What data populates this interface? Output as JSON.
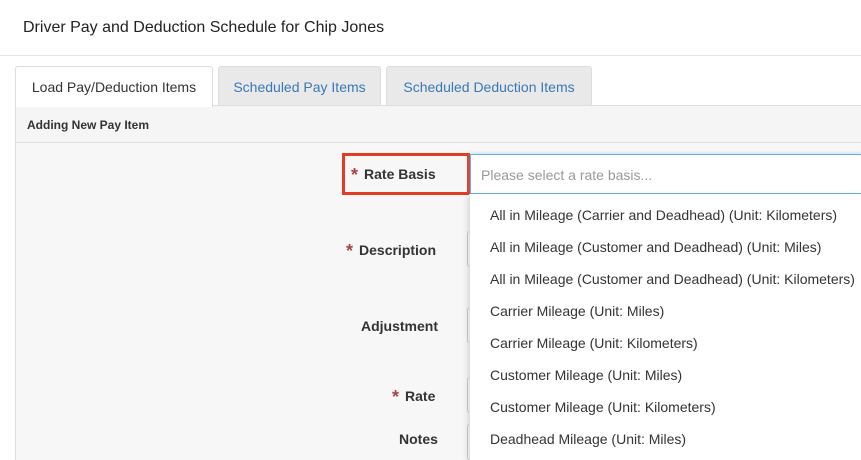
{
  "modal": {
    "title": "Driver Pay and Deduction Schedule for Chip Jones"
  },
  "tabs": [
    {
      "label": "Load Pay/Deduction Items",
      "active": true
    },
    {
      "label": "Scheduled Pay Items",
      "active": false
    },
    {
      "label": "Scheduled Deduction Items",
      "active": false
    }
  ],
  "panel": {
    "heading": "Adding New Pay Item"
  },
  "form": {
    "required_marker": "*",
    "rate_basis_label": "Rate Basis",
    "rate_basis_placeholder": "Please select a rate basis...",
    "description_label": "Description",
    "adjustment_label": "Adjustment",
    "rate_label": "Rate",
    "notes_label": "Notes"
  },
  "dropdown": {
    "options": [
      "All in Mileage (Carrier and Deadhead) (Unit: Kilometers)",
      "All in Mileage (Customer and Deadhead) (Unit: Miles)",
      "All in Mileage (Customer and Deadhead) (Unit: Kilometers)",
      "Carrier Mileage (Unit: Miles)",
      "Carrier Mileage (Unit: Kilometers)",
      "Customer Mileage (Unit: Miles)",
      "Customer Mileage (Unit: Kilometers)",
      "Deadhead Mileage (Unit: Miles)"
    ]
  },
  "colors": {
    "highlight": "#e53b25",
    "link": "#3a78b5",
    "required": "#a94442"
  }
}
